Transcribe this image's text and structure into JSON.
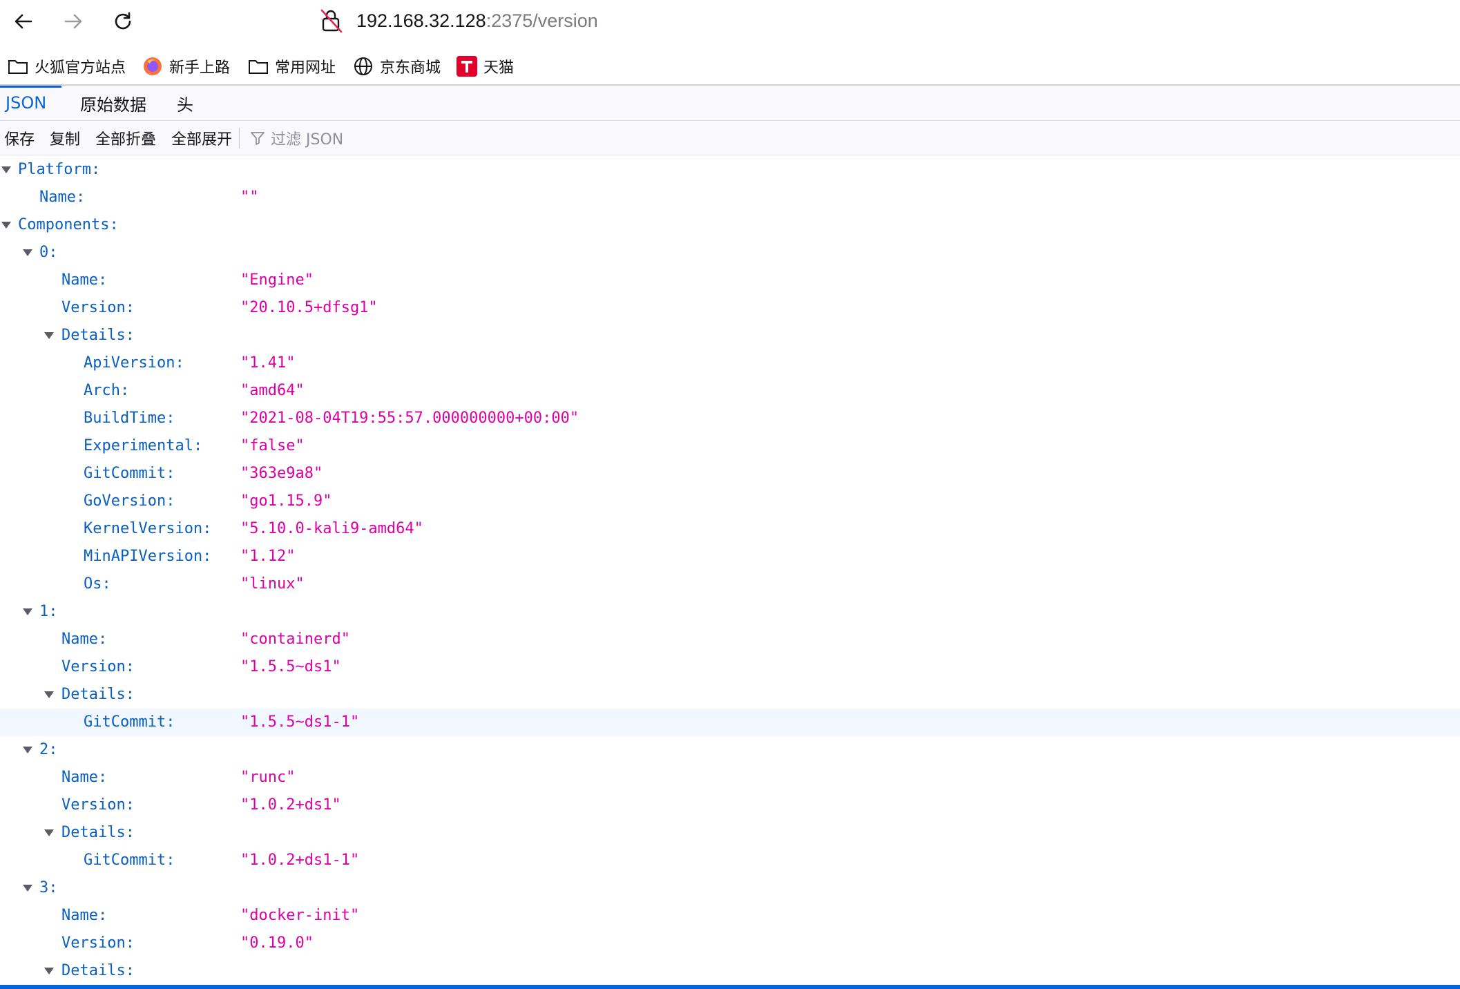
{
  "browser": {
    "url_host": "192.168.32.128",
    "url_rest": ":2375/version",
    "icons": {
      "back": "back-arrow-icon",
      "forward": "forward-arrow-icon",
      "reload": "reload-icon",
      "lock": "insecure-lock-icon"
    }
  },
  "bookmarks": [
    {
      "label": "火狐官方站点",
      "icon": "folder-icon"
    },
    {
      "label": "新手上路",
      "icon": "firefox-icon"
    },
    {
      "label": "常用网址",
      "icon": "folder-icon"
    },
    {
      "label": "京东商城",
      "icon": "globe-icon"
    },
    {
      "label": "天猫",
      "icon": "tmall-icon"
    }
  ],
  "viewer": {
    "tabs": [
      {
        "label": "JSON",
        "active": true
      },
      {
        "label": "原始数据",
        "active": false
      },
      {
        "label": "头",
        "active": false
      }
    ],
    "toolbar": {
      "save": "保存",
      "copy": "复制",
      "collapse_all": "全部折叠",
      "expand_all": "全部展开",
      "filter_placeholder": "过滤 JSON"
    }
  },
  "json_tree": [
    {
      "key": "Platform:",
      "value": "",
      "depth": 0,
      "expander": true
    },
    {
      "key": "Name:",
      "value": "\"\"",
      "depth": 1,
      "expander": false
    },
    {
      "key": "Components:",
      "value": "",
      "depth": 0,
      "expander": true
    },
    {
      "key": "0:",
      "value": "",
      "depth": 1,
      "expander": true
    },
    {
      "key": "Name:",
      "value": "\"Engine\"",
      "depth": 2,
      "expander": false
    },
    {
      "key": "Version:",
      "value": "\"20.10.5+dfsg1\"",
      "depth": 2,
      "expander": false
    },
    {
      "key": "Details:",
      "value": "",
      "depth": 2,
      "expander": true
    },
    {
      "key": "ApiVersion:",
      "value": "\"1.41\"",
      "depth": 3,
      "expander": false
    },
    {
      "key": "Arch:",
      "value": "\"amd64\"",
      "depth": 3,
      "expander": false
    },
    {
      "key": "BuildTime:",
      "value": "\"2021-08-04T19:55:57.000000000+00:00\"",
      "depth": 3,
      "expander": false
    },
    {
      "key": "Experimental:",
      "value": "\"false\"",
      "depth": 3,
      "expander": false
    },
    {
      "key": "GitCommit:",
      "value": "\"363e9a8\"",
      "depth": 3,
      "expander": false
    },
    {
      "key": "GoVersion:",
      "value": "\"go1.15.9\"",
      "depth": 3,
      "expander": false
    },
    {
      "key": "KernelVersion:",
      "value": "\"5.10.0-kali9-amd64\"",
      "depth": 3,
      "expander": false
    },
    {
      "key": "MinAPIVersion:",
      "value": "\"1.12\"",
      "depth": 3,
      "expander": false
    },
    {
      "key": "Os:",
      "value": "\"linux\"",
      "depth": 3,
      "expander": false
    },
    {
      "key": "1:",
      "value": "",
      "depth": 1,
      "expander": true
    },
    {
      "key": "Name:",
      "value": "\"containerd\"",
      "depth": 2,
      "expander": false
    },
    {
      "key": "Version:",
      "value": "\"1.5.5~ds1\"",
      "depth": 2,
      "expander": false
    },
    {
      "key": "Details:",
      "value": "",
      "depth": 2,
      "expander": true
    },
    {
      "key": "GitCommit:",
      "value": "\"1.5.5~ds1-1\"",
      "depth": 3,
      "expander": false,
      "highlighted": true
    },
    {
      "key": "2:",
      "value": "",
      "depth": 1,
      "expander": true
    },
    {
      "key": "Name:",
      "value": "\"runc\"",
      "depth": 2,
      "expander": false
    },
    {
      "key": "Version:",
      "value": "\"1.0.2+ds1\"",
      "depth": 2,
      "expander": false
    },
    {
      "key": "Details:",
      "value": "",
      "depth": 2,
      "expander": true
    },
    {
      "key": "GitCommit:",
      "value": "\"1.0.2+ds1-1\"",
      "depth": 3,
      "expander": false
    },
    {
      "key": "3:",
      "value": "",
      "depth": 1,
      "expander": true
    },
    {
      "key": "Name:",
      "value": "\"docker-init\"",
      "depth": 2,
      "expander": false
    },
    {
      "key": "Version:",
      "value": "\"0.19.0\"",
      "depth": 2,
      "expander": false
    },
    {
      "key": "Details:",
      "value": "",
      "depth": 2,
      "expander": true
    }
  ]
}
